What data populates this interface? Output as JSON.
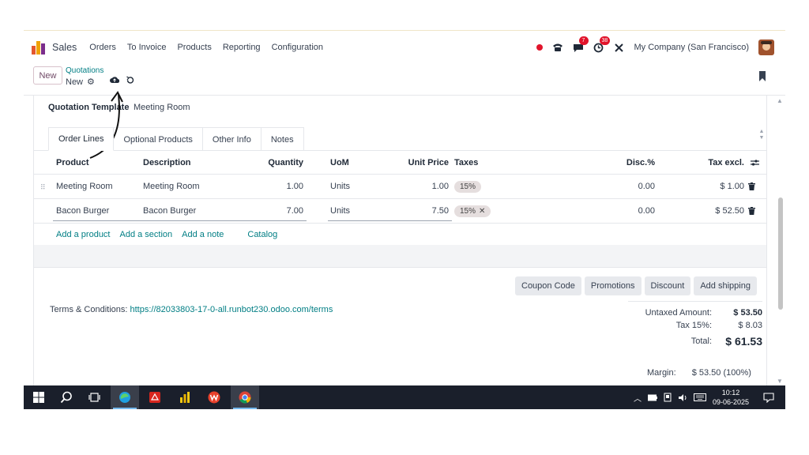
{
  "navbar": {
    "app_name": "Sales",
    "menu": [
      "Orders",
      "To Invoice",
      "Products",
      "Reporting",
      "Configuration"
    ],
    "chat_badge": "7",
    "activity_badge": "38",
    "company": "My Company (San Francisco)"
  },
  "control_panel": {
    "new_button": "New",
    "breadcrumb": "Quotations",
    "record_name": "New"
  },
  "form": {
    "template_label": "Quotation Template",
    "template_value": "Meeting Room",
    "tabs": [
      "Order Lines",
      "Optional Products",
      "Other Info",
      "Notes"
    ],
    "columns": {
      "product": "Product",
      "description": "Description",
      "quantity": "Quantity",
      "uom": "UoM",
      "unit_price": "Unit Price",
      "taxes": "Taxes",
      "discount": "Disc.%",
      "tax_excl": "Tax excl."
    },
    "lines": [
      {
        "product": "Meeting Room",
        "description": "Meeting Room",
        "quantity": "1.00",
        "uom": "Units",
        "unit_price": "1.00",
        "tax": "15%",
        "discount": "0.00",
        "subtotal": "$ 1.00"
      },
      {
        "product": "Bacon Burger",
        "description": "Bacon Burger",
        "quantity": "7.00",
        "uom": "Units",
        "unit_price": "7.50",
        "tax": "15%",
        "discount": "0.00",
        "subtotal": "$ 52.50"
      }
    ],
    "add_links": {
      "product": "Add a product",
      "section": "Add a section",
      "note": "Add a note",
      "catalog": "Catalog"
    },
    "action_buttons": [
      "Coupon Code",
      "Promotions",
      "Discount",
      "Add shipping"
    ],
    "terms_label": "Terms & Conditions:",
    "terms_link": "https://82033803-17-0-all.runbot230.odoo.com/terms",
    "totals": {
      "untaxed_label": "Untaxed Amount:",
      "untaxed_value": "$ 53.50",
      "tax_label": "Tax 15%:",
      "tax_value": "$ 8.03",
      "total_label": "Total:",
      "total_value": "$ 61.53",
      "margin_label": "Margin:",
      "margin_value": "$ 53.50 (100%)"
    }
  },
  "taskbar": {
    "time": "10:12",
    "date": "09-06-2025"
  },
  "colors": {
    "accent": "#017e84",
    "brand": "#714b67",
    "badge": "#e1142b"
  }
}
